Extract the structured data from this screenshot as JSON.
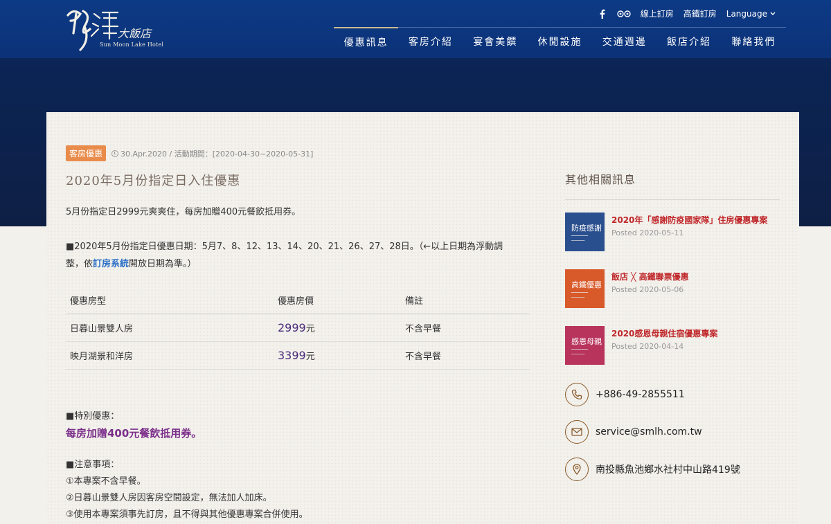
{
  "header": {
    "logo_text": "日月潭大飯店",
    "logo_en": "Sun Moon Lake Hotel",
    "util": {
      "facebook_icon": "facebook-icon",
      "tripadvisor_icon": "tripadvisor-icon",
      "online_booking": "線上訂房",
      "hsr_booking": "高鐵訂房",
      "language": "Language"
    },
    "nav": [
      "優惠訊息",
      "客房介紹",
      "宴會美饌",
      "休閒設施",
      "交通週邊",
      "飯店介紹",
      "聯絡我們"
    ]
  },
  "article": {
    "badge": "客房優惠",
    "meta": "30.Apr.2020 / 活動期間：[2020-04-30~2020-05-31]",
    "title": "2020年5月份指定日入住優惠",
    "intro": "5月份指定日2999元爽爽住，每房加贈400元餐飲抵用券。",
    "dates_line1": "■2020年5月份指定日優惠日期：5月7、8、12、13、14、20、21、26、27、28日。（←以上日期為浮動調",
    "dates_line2_pre": "整，依",
    "dates_link": "訂房系統",
    "dates_line2_post": "開放日期為準。）",
    "table": {
      "headers": [
        "優惠房型",
        "優惠房價",
        "備註"
      ],
      "rows": [
        {
          "room": "日暮山景雙人房",
          "price": "2999",
          "unit": "元",
          "note": "不含早餐"
        },
        {
          "room": "映月湖景和洋房",
          "price": "3399",
          "unit": "元",
          "note": "不含早餐"
        }
      ]
    },
    "special_label": "■特別優惠：",
    "special_text": "每房加贈400元餐飲抵用券。",
    "notice_label": "■注意事項：",
    "notices": [
      "①本專案不含早餐。",
      "②日暮山景雙人房因客房空間設定，無法加人加床。",
      "③使用本專案須事先訂房，且不得與其他優惠專案合併使用。"
    ]
  },
  "sidebar": {
    "title": "其他相關訊息",
    "posts": [
      {
        "title": "2020年「感謝防疫國家隊」住房優惠專案",
        "date": "Posted 2020-05-11",
        "thumb_text": "防疫感謝",
        "color": "#2a4f8e"
      },
      {
        "title": "飯店 ╳ 高鐵聯票優惠",
        "date": "Posted 2020-05-06",
        "thumb_text": "高鐵優惠",
        "color": "#d85a2a"
      },
      {
        "title": "2020感恩母親住宿優惠專案",
        "date": "Posted 2020-04-14",
        "thumb_text": "感恩母親",
        "color": "#b8345c"
      }
    ],
    "contacts": {
      "phone": "+886-49-2855511",
      "email": "service@smlh.com.tw",
      "address": "南投縣魚池鄉水社村中山路419號"
    }
  }
}
